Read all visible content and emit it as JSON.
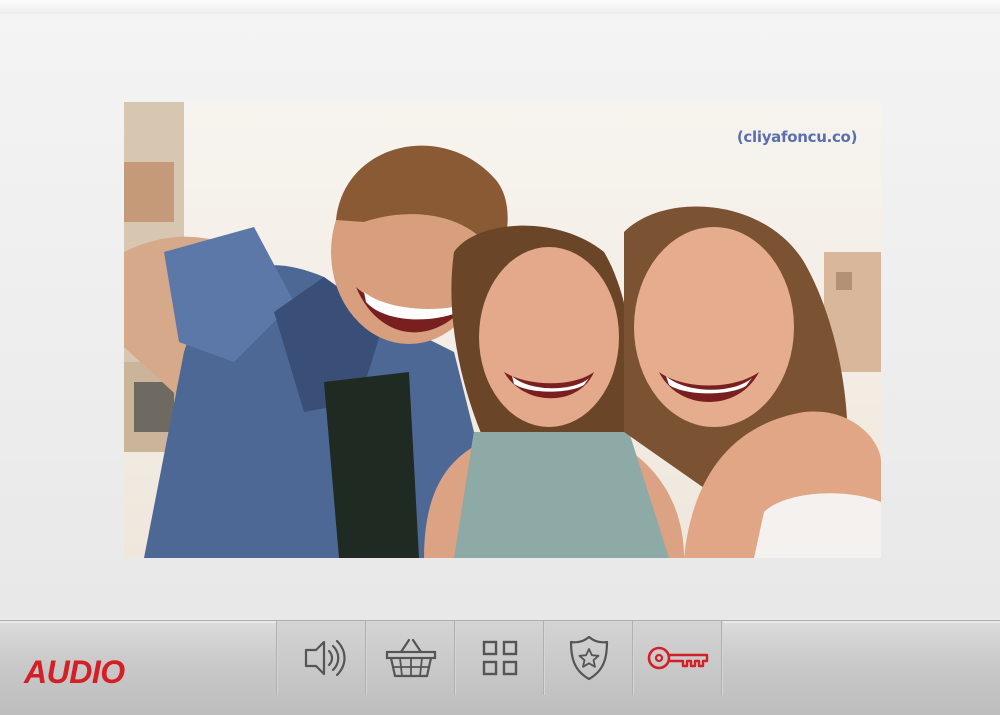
{
  "device": {
    "brand": "AUDIO"
  },
  "screen": {
    "watermark": "(cliyafoncu.co)"
  },
  "buttons": [
    {
      "name": "speaker-button",
      "icon": "speaker-icon"
    },
    {
      "name": "basket-button",
      "icon": "basket-icon"
    },
    {
      "name": "menu-grid-button",
      "icon": "grid-icon"
    },
    {
      "name": "security-button",
      "icon": "police-badge-icon"
    },
    {
      "name": "door-key-button",
      "icon": "key-icon"
    }
  ],
  "colors": {
    "brand": "#d31f26",
    "icon": "#555555",
    "key_icon": "#d31f26",
    "watermark": "#5a6fb0"
  }
}
